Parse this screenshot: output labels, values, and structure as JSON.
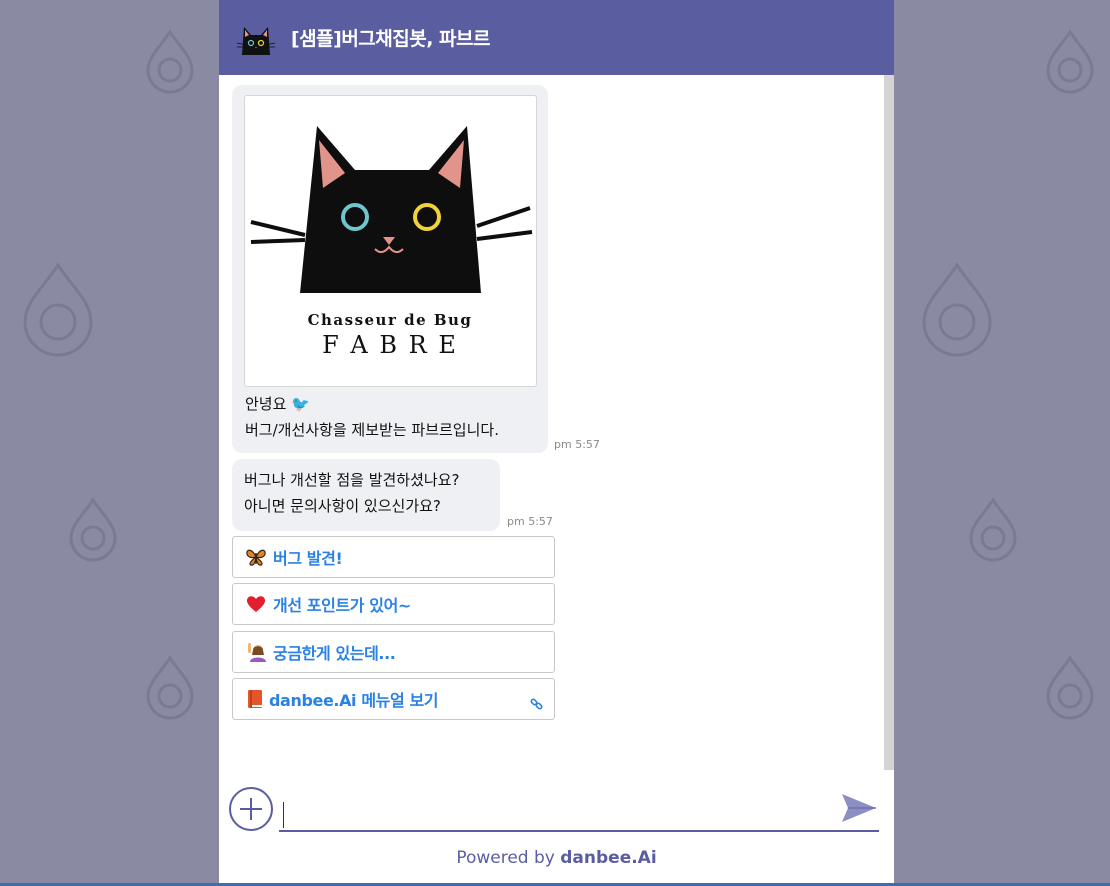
{
  "header": {
    "title": "[샘플]버그채집봇, 파브르"
  },
  "messages": [
    {
      "card_caption_top": "Chasseur de Bug",
      "card_caption_bottom": "F A B R E",
      "line1": "안녕요 🐦",
      "line2": "버그/개선사항을 제보받는 파브르입니다.",
      "time": "pm 5:57"
    },
    {
      "line1": "버그나 개선할 점을 발견하셨나요?",
      "line2": "아니면 문의사항이 있으신가요?",
      "time": "pm 5:57"
    }
  ],
  "quick_replies": [
    {
      "icon": "butterfly-icon",
      "label": "버그 발견!"
    },
    {
      "icon": "heart-icon",
      "label": "개선 포인트가 있어~"
    },
    {
      "icon": "raising-hand-icon",
      "label": "궁금한게 있는데..."
    },
    {
      "icon": "book-icon",
      "label": "danbee.Ai 메뉴얼 보기",
      "external_link": true
    }
  ],
  "input": {
    "placeholder": ""
  },
  "footer": {
    "powered_prefix": "Powered by",
    "powered_brand": "danbee.Ai"
  },
  "colors": {
    "header": "#5a5da0",
    "bubble": "#eef0f3",
    "quick_reply_text": "#2a82e4",
    "background": "#8a8ba3"
  }
}
